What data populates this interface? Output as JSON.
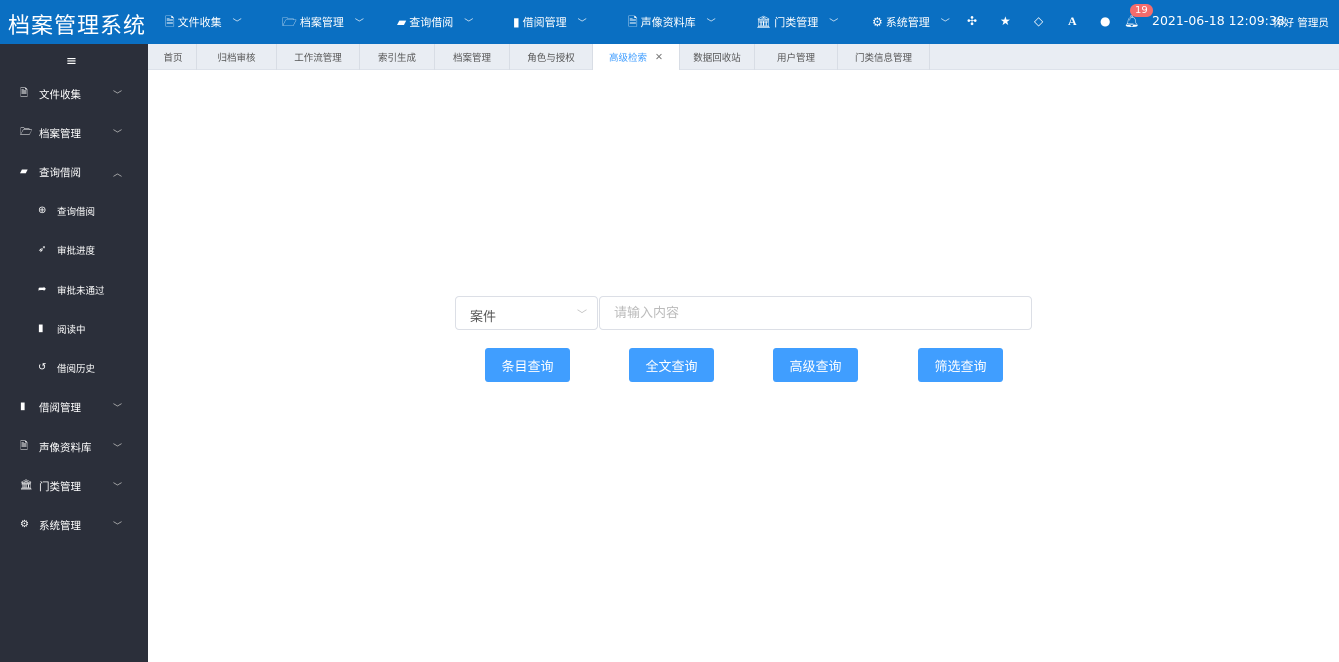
{
  "header": {
    "logo": "档案管理系统",
    "nav": [
      {
        "label": "文件收集",
        "icon": "file-pdf-icon"
      },
      {
        "label": "档案管理",
        "icon": "folder-open-icon"
      },
      {
        "label": "查询借阅",
        "icon": "book-icon"
      },
      {
        "label": "借阅管理",
        "icon": "bookmark-icon"
      },
      {
        "label": "声像资料库",
        "icon": "media-file-icon"
      },
      {
        "label": "门类管理",
        "icon": "institution-icon"
      },
      {
        "label": "系统管理",
        "icon": "cogs-icon"
      }
    ],
    "notification_count": "19",
    "datetime": "2021-06-18 12:09:38",
    "user": "你好 管理员",
    "accent": "#0a6fc2"
  },
  "sidebar": {
    "items": [
      {
        "label": "文件收集",
        "icon": "file-pdf-icon"
      },
      {
        "label": "档案管理",
        "icon": "folder-open-icon"
      },
      {
        "label": "查询借阅",
        "icon": "book-icon"
      },
      {
        "label": "查询借阅",
        "icon": "search-plus-icon"
      },
      {
        "label": "审批进度",
        "icon": "paper-plane-icon"
      },
      {
        "label": "审批未通过",
        "icon": "share-icon"
      },
      {
        "label": "阅读中",
        "icon": "bookmark-icon"
      },
      {
        "label": "借阅历史",
        "icon": "history-icon"
      },
      {
        "label": "借阅管理",
        "icon": "bookmark-icon"
      },
      {
        "label": "声像资料库",
        "icon": "media-file-icon"
      },
      {
        "label": "门类管理",
        "icon": "institution-icon"
      },
      {
        "label": "系统管理",
        "icon": "cogs-icon"
      }
    ]
  },
  "tabs": [
    {
      "label": "首页"
    },
    {
      "label": "归档审核"
    },
    {
      "label": "工作流管理"
    },
    {
      "label": "索引生成"
    },
    {
      "label": "档案管理"
    },
    {
      "label": "角色与授权"
    },
    {
      "label": "高级检索",
      "active": true
    },
    {
      "label": "数据回收站"
    },
    {
      "label": "用户管理"
    },
    {
      "label": "门类信息管理"
    }
  ],
  "search": {
    "type_selected": "案件",
    "placeholder": "请输入内容",
    "value": "",
    "buttons": [
      "条目查询",
      "全文查询",
      "高级查询",
      "筛选查询"
    ],
    "button_color": "#409eff"
  }
}
